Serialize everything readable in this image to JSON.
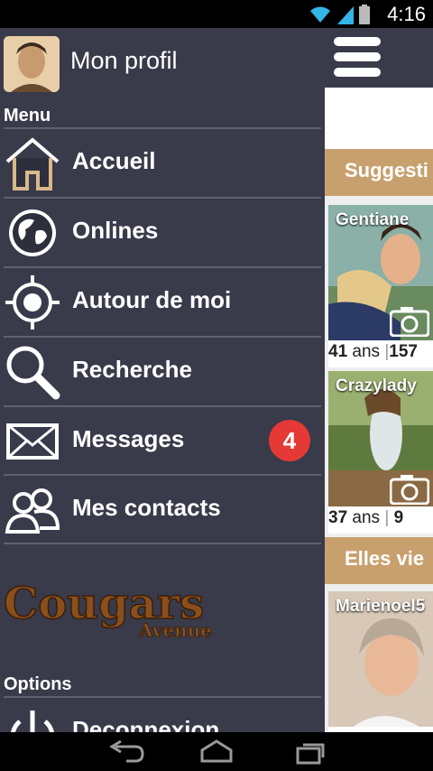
{
  "status": {
    "time": "4:16"
  },
  "drawer": {
    "profile_name": "Mon profil",
    "menu_title": "Menu",
    "items": [
      {
        "label": "Accueil",
        "icon": "home-icon"
      },
      {
        "label": "Onlines",
        "icon": "globe-icon"
      },
      {
        "label": "Autour de moi",
        "icon": "location-target-icon"
      },
      {
        "label": "Recherche",
        "icon": "magnifier-icon"
      },
      {
        "label": "Messages",
        "icon": "envelope-icon",
        "badge": "4"
      },
      {
        "label": "Mes contacts",
        "icon": "contacts-icon"
      }
    ],
    "logo_text": "Cougars",
    "logo_subtext": "Avenue",
    "options_title": "Options",
    "logout_label": "Deconnexion"
  },
  "content": {
    "section1_title": "Suggesti",
    "section2_title": "Elles vie",
    "cards": [
      {
        "name": "Gentiane",
        "age": "41",
        "age_unit": "ans",
        "extra": "157"
      },
      {
        "name": "Crazylady",
        "age": "37",
        "age_unit": "ans",
        "extra": "9"
      },
      {
        "name": "Marienoel5"
      }
    ]
  },
  "colors": {
    "drawer_bg": "#393a4a",
    "accent": "#c8a06e",
    "badge": "#e53935"
  }
}
